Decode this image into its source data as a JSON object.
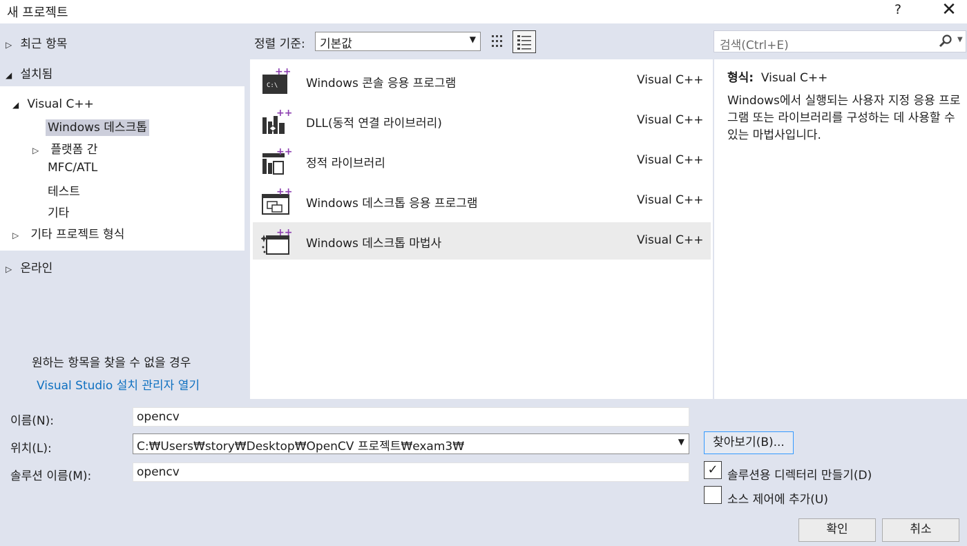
{
  "window": {
    "title": "새 프로젝트",
    "help": "?",
    "close": "✕"
  },
  "left_panel": {
    "recent": "최근 항목",
    "installed": "설치됨",
    "tree": {
      "visual_cpp": "Visual C++",
      "windows_desktop": "Windows 데스크톱",
      "cross_platform": "플랫폼 간",
      "mfc_atl": "MFC/ATL",
      "test": "테스트",
      "other": "기타",
      "other_project_types": "기타 프로젝트 형식"
    },
    "online": "온라인",
    "hint": "원하는 항목을 찾을 수 없을 경우",
    "installer_link": "Visual Studio 설치 관리자 열기"
  },
  "sort": {
    "label": "정렬 기준:",
    "value": "기본값"
  },
  "search": {
    "placeholder": "검색(Ctrl+E)"
  },
  "templates": [
    {
      "name": "Windows 콘솔 응용 프로그램",
      "lang": "Visual C++",
      "icon": "console-app-icon"
    },
    {
      "name": "DLL(동적 연결 라이브러리)",
      "lang": "Visual C++",
      "icon": "dll-icon"
    },
    {
      "name": "정적 라이브러리",
      "lang": "Visual C++",
      "icon": "static-library-icon"
    },
    {
      "name": "Windows 데스크톱 응용 프로그램",
      "lang": "Visual C++",
      "icon": "desktop-app-icon"
    },
    {
      "name": "Windows 데스크톱 마법사",
      "lang": "Visual C++",
      "icon": "desktop-wizard-icon",
      "selected": true
    }
  ],
  "description": {
    "type_label": "형식:",
    "type_value": "Visual C++",
    "text": "Windows에서 실행되는 사용자 지정 응용 프로그램 또는 라이브러리를 구성하는 데 사용할 수 있는 마법사입니다."
  },
  "form": {
    "name_label": "이름(N):",
    "name_value": "opencv",
    "location_label": "위치(L):",
    "location_value": "C:₩Users₩story₩Desktop₩OpenCV 프로젝트₩exam3₩",
    "solution_label": "솔루션 이름(M):",
    "solution_value": "opencv",
    "browse": "찾아보기(B)...",
    "create_dir_label": "솔루션용 디렉터리 만들기(D)",
    "create_dir_checked": true,
    "source_control_label": "소스 제어에 추가(U)",
    "source_control_checked": false,
    "ok": "확인",
    "cancel": "취소"
  },
  "colors": {
    "accent_purple": "#8c3fb0",
    "link_blue": "#0e70c0",
    "panel_bg": "#dfe3ee"
  }
}
